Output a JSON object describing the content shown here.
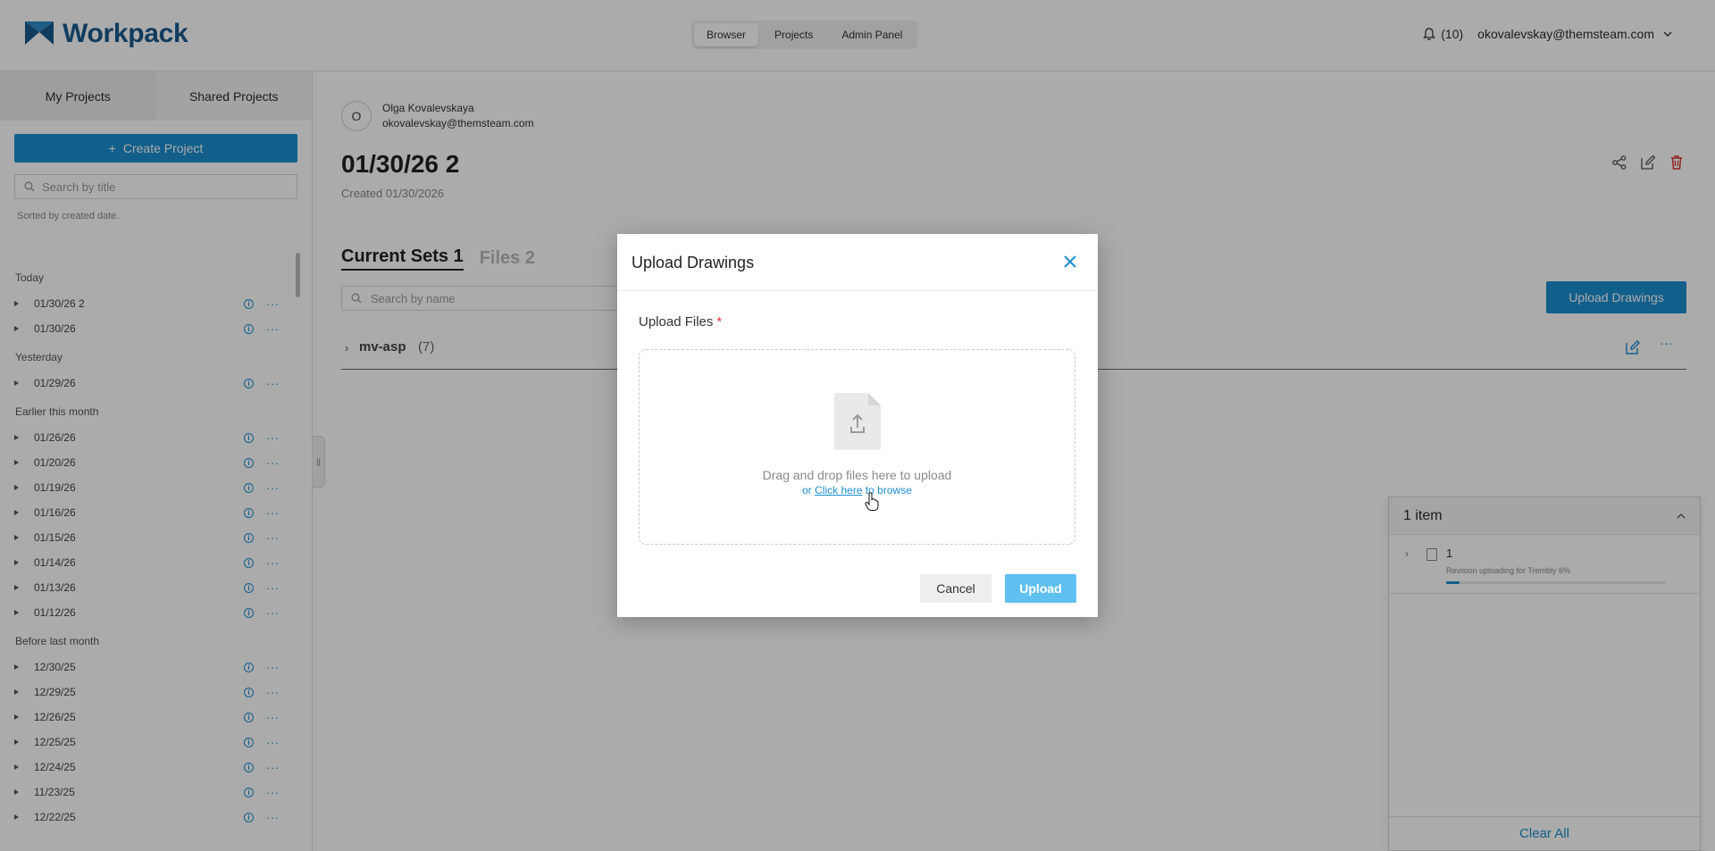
{
  "header": {
    "logo_text": "Workpack",
    "nav": [
      "Browser",
      "Projects",
      "Admin Panel"
    ],
    "active_nav": "Browser",
    "notifications_label": "(10)",
    "user_email": "okovalevskay@themsteam.com"
  },
  "sidebar": {
    "tabs": [
      "My Projects",
      "Shared Projects"
    ],
    "create_label": "Create Project",
    "search_placeholder": "Search by title",
    "sorted_text": "Sorted by created date.",
    "groups": [
      {
        "label": "Today",
        "items": [
          "01/30/26 2",
          "01/30/26"
        ]
      },
      {
        "label": "Yesterday",
        "items": [
          "01/29/26"
        ]
      },
      {
        "label": "Earlier this month",
        "items": [
          "01/26/26",
          "01/20/26",
          "01/19/26",
          "01/16/26",
          "01/15/26",
          "01/14/26",
          "01/13/26",
          "01/12/26"
        ]
      },
      {
        "label": "Before last month",
        "items": [
          "12/30/25",
          "12/29/25",
          "12/26/25",
          "12/25/25",
          "12/24/25",
          "11/23/25",
          "12/22/25"
        ]
      }
    ]
  },
  "main": {
    "owner_initial": "O",
    "owner_name": "Olga Kovalevskaya",
    "owner_email": "okovalevskay@themsteam.com",
    "title": "01/30/26 2",
    "created": "Created 01/30/2026",
    "tabs": [
      {
        "label": "Current Sets",
        "count": "1"
      },
      {
        "label": "Files",
        "count": "2"
      }
    ],
    "search_placeholder": "Search by name",
    "upload_button": "Upload Drawings",
    "set": {
      "name": "mv-asp",
      "count": "(7)"
    }
  },
  "queue": {
    "title": "1 item",
    "items": [
      {
        "name": "1",
        "status": "Revision uploading for Trembly 6%",
        "progress": 0.06
      }
    ],
    "clear_label": "Clear All"
  },
  "modal": {
    "title": "Upload Drawings",
    "field_label": "Upload Files",
    "required_mark": "*",
    "drop_text": "Drag and drop files here to upload",
    "browse_prefix": "or",
    "browse_link": "Click here",
    "browse_suffix": "to browse",
    "cancel_label": "Cancel",
    "upload_label": "Upload"
  },
  "colors": {
    "accent": "#1c8ed0",
    "logo": "#1a5a8c",
    "danger": "#d33"
  }
}
